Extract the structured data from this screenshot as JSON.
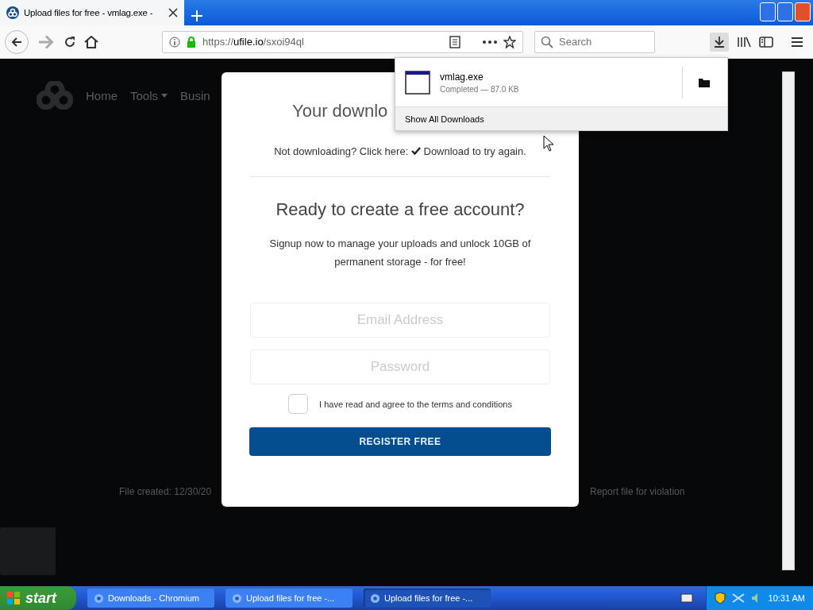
{
  "browser": {
    "tab": {
      "title": "Upload files for free - vmlag.exe -",
      "selected": true
    },
    "url": {
      "prefix": "https://",
      "host": "ufile.io",
      "path": "/sxoi94ql"
    },
    "search": {
      "placeholder": "Search"
    }
  },
  "site": {
    "nav": [
      "Home",
      "Tools",
      "Busin"
    ],
    "file_created": "File created: 12/30/20",
    "report": "Report file for violation"
  },
  "downloads_panel": {
    "items": [
      {
        "name": "vmlag.exe",
        "status": "Completed — 87.0 KB"
      }
    ],
    "footer": "Show All Downloads"
  },
  "modal": {
    "title": "Your downlo",
    "retry_prefix": "Not downloading? Click here:",
    "retry_link": "Download to try again.",
    "heading": "Ready to create a free account?",
    "description": "Signup now to manage your uploads and unlock 10GB of permanent storage - for free!",
    "fields": [
      {
        "placeholder": "Email Address"
      },
      {
        "placeholder": "Password"
      }
    ],
    "terms": {
      "label": "I have read and agree to the terms and conditions",
      "checked": false
    },
    "button": "REGISTER FREE"
  },
  "taskbar": {
    "start": "start",
    "tasks": [
      {
        "title": "Downloads - Chromium",
        "selected": false
      },
      {
        "title": "Upload files for free -...",
        "selected": false
      },
      {
        "title": "Upload files for free -...",
        "selected": true
      }
    ],
    "clock": "10:31 AM"
  }
}
